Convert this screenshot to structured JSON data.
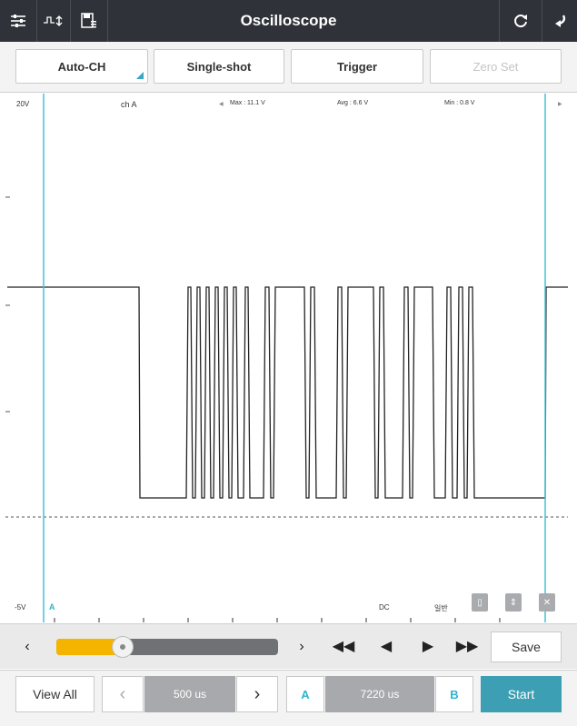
{
  "app": {
    "title": "Oscilloscope"
  },
  "toolbar": {
    "buttons": [
      {
        "label": "Auto-CH"
      },
      {
        "label": "Single-shot"
      },
      {
        "label": "Trigger"
      },
      {
        "label": "Zero Set"
      }
    ]
  },
  "scope": {
    "scale_top": "20V",
    "scale_bottom": "-5V",
    "channel": "ch A",
    "max": "Max : 11.1 V",
    "avg": "Avg : 6.6 V",
    "min": "Min : 0.8 V",
    "cursor_a_label": "A",
    "coupling": "DC",
    "mode": "일반",
    "trace_color": "#222222",
    "cursor_color": "#40c4d6"
  },
  "playback": {
    "slider_fraction": 0.3,
    "save_label": "Save"
  },
  "bottombar": {
    "view_all_label": "View All",
    "timebase": "500 us",
    "cursor_a_label": "A",
    "cursor_value": "7220 us",
    "cursor_b_label": "B",
    "start_label": "Start"
  },
  "colors": {
    "accent": "#3d9fb3",
    "slider_fill": "#f4b400",
    "titlebar": "#2f3238"
  }
}
